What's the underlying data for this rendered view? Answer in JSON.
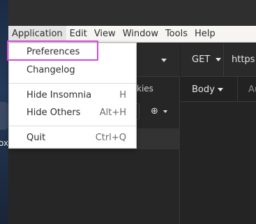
{
  "desktop": {
    "partial_label": "ox"
  },
  "menubar": {
    "items": [
      "Application",
      "Edit",
      "View",
      "Window",
      "Tools",
      "Help"
    ]
  },
  "sidebar": {
    "cookies_label": "kies"
  },
  "request": {
    "method": "GET",
    "url": "https:",
    "tabs": [
      "Body",
      "Au"
    ]
  },
  "app_menu": {
    "items": [
      {
        "label": "Preferences",
        "shortcut": ""
      },
      {
        "label": "Changelog",
        "shortcut": ""
      },
      {
        "label": "Hide Insomnia",
        "shortcut": "H"
      },
      {
        "label": "Hide Others",
        "shortcut": "Alt+H"
      },
      {
        "label": "Quit",
        "shortcut": "Ctrl+Q"
      }
    ],
    "highlighted": "Preferences"
  },
  "colors": {
    "highlight_box": "#d34ad8",
    "menubar_bg": "#f6f5f4",
    "app_dark_bg": "#222222"
  }
}
